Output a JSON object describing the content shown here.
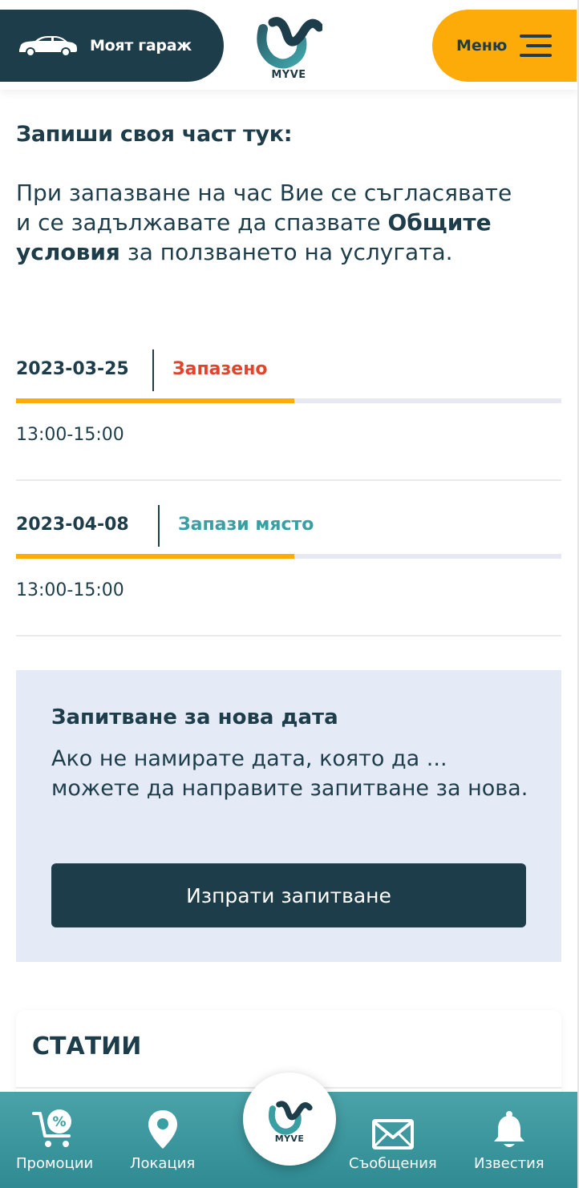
{
  "header": {
    "garage_label": "Моят гараж",
    "logo_text": "MYVE",
    "menu_label": "Меню"
  },
  "main": {
    "title": "Запиши своя част тук:",
    "intro_before": "При запазване на час Вие се съгласявате и се задължавате да спазвате ",
    "intro_bold": "Общите условия",
    "intro_after": " за ползването на услугата.",
    "slots": [
      {
        "date": "2023-03-25",
        "status": "Запазено",
        "status_color": "#e2432a",
        "time": "13:00-15:00",
        "progress": 0.51
      },
      {
        "date": "2023-04-08",
        "status": "Запази място",
        "status_color": "#3a9fa3",
        "time": "13:00-15:00",
        "progress": 0.51
      }
    ]
  },
  "request": {
    "title": "Запитване за нова дата",
    "text": "Ако не намирате дата, която да ... можете да направите запитване за нова.",
    "button": "Изпрати запитване"
  },
  "articles": {
    "title": "СТАТИИ"
  },
  "bottom_nav": {
    "items": [
      {
        "label": "Промоции",
        "icon": "cart-percent-icon"
      },
      {
        "label": "Локация",
        "icon": "location-pin-icon"
      },
      {
        "label": "Съобщения",
        "icon": "envelope-icon"
      },
      {
        "label": "Известия",
        "icon": "bell-icon"
      }
    ],
    "center_logo_text": "MYVE"
  },
  "colors": {
    "navy": "#1e3d4a",
    "accent_yellow": "#fcab08",
    "teal": "#3a9fa3",
    "reserved_red": "#e2432a",
    "card_bg": "#e4eaf6"
  }
}
